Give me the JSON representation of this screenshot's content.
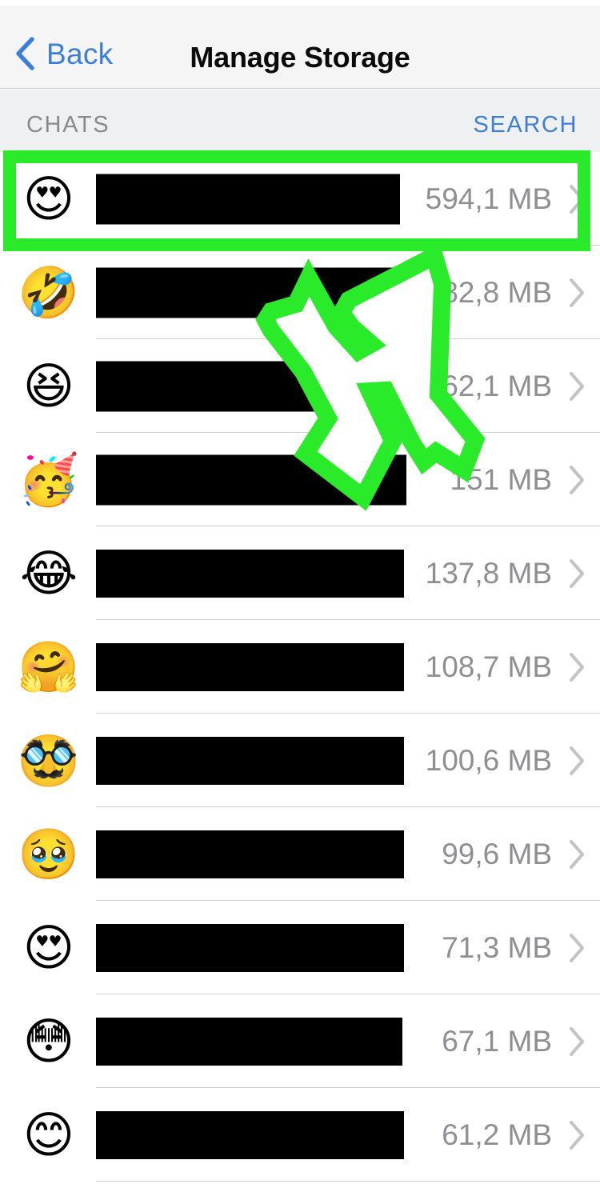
{
  "navbar": {
    "back_label": "Back",
    "title": "Manage Storage",
    "back_icon": "chevron-left-icon",
    "accent_color": "#3b7fdb"
  },
  "section_header": {
    "left_label": "CHATS",
    "right_label": "SEARCH"
  },
  "annotation": {
    "highlight_color": "#2aeb2a",
    "arrow_color": "#2aeb2a",
    "highlight_target_row_index": 0,
    "arrow_points_to": "first-chat-row"
  },
  "chats": {
    "rows": [
      {
        "emoji": "😍",
        "emoji_name": "smiling-face-with-heart-eyes",
        "name_redacted": true,
        "redaction_width": 380,
        "redaction_height": 63,
        "size": "594,1 MB",
        "chevron": "chevron-right-icon"
      },
      {
        "emoji": "🤣",
        "emoji_name": "rolling-on-the-floor-laughing",
        "name_redacted": true,
        "redaction_width": 385,
        "redaction_height": 63,
        "size": "382,8 MB",
        "chevron": "chevron-right-icon"
      },
      {
        "emoji": "😆",
        "emoji_name": "grinning-squinting-face",
        "name_redacted": true,
        "redaction_width": 388,
        "redaction_height": 63,
        "size": "162,1 MB",
        "chevron": "chevron-right-icon"
      },
      {
        "emoji": "🥳",
        "emoji_name": "partying-face",
        "name_redacted": true,
        "redaction_width": 388,
        "redaction_height": 63,
        "size": "151 MB",
        "chevron": "chevron-right-icon"
      },
      {
        "emoji": "😂",
        "emoji_name": "face-with-tears-of-joy",
        "name_redacted": true,
        "redaction_width": 385,
        "redaction_height": 60,
        "size": "137,8 MB",
        "chevron": "chevron-right-icon"
      },
      {
        "emoji": "🤗",
        "emoji_name": "hugging-face",
        "name_redacted": true,
        "redaction_width": 385,
        "redaction_height": 60,
        "size": "108,7 MB",
        "chevron": "chevron-right-icon"
      },
      {
        "emoji": "🥸",
        "emoji_name": "disguised-face",
        "name_redacted": true,
        "redaction_width": 385,
        "redaction_height": 60,
        "size": "100,6 MB",
        "chevron": "chevron-right-icon"
      },
      {
        "emoji": "🥹",
        "emoji_name": "face-holding-back-tears",
        "name_redacted": true,
        "redaction_width": 385,
        "redaction_height": 60,
        "size": "99,6 MB",
        "chevron": "chevron-right-icon"
      },
      {
        "emoji": "😍",
        "emoji_name": "smiling-face-with-heart-eyes",
        "name_redacted": true,
        "redaction_width": 385,
        "redaction_height": 60,
        "size": "71,3 MB",
        "chevron": "chevron-right-icon"
      },
      {
        "emoji": "😳",
        "emoji_name": "flushed-face",
        "name_redacted": true,
        "redaction_width": 383,
        "redaction_height": 60,
        "size": "67,1 MB",
        "chevron": "chevron-right-icon"
      },
      {
        "emoji": "😊",
        "emoji_name": "smiling-face-with-smiling-eyes",
        "name_redacted": true,
        "redaction_width": 385,
        "redaction_height": 60,
        "size": "61,2 MB",
        "chevron": "chevron-right-icon"
      }
    ]
  }
}
